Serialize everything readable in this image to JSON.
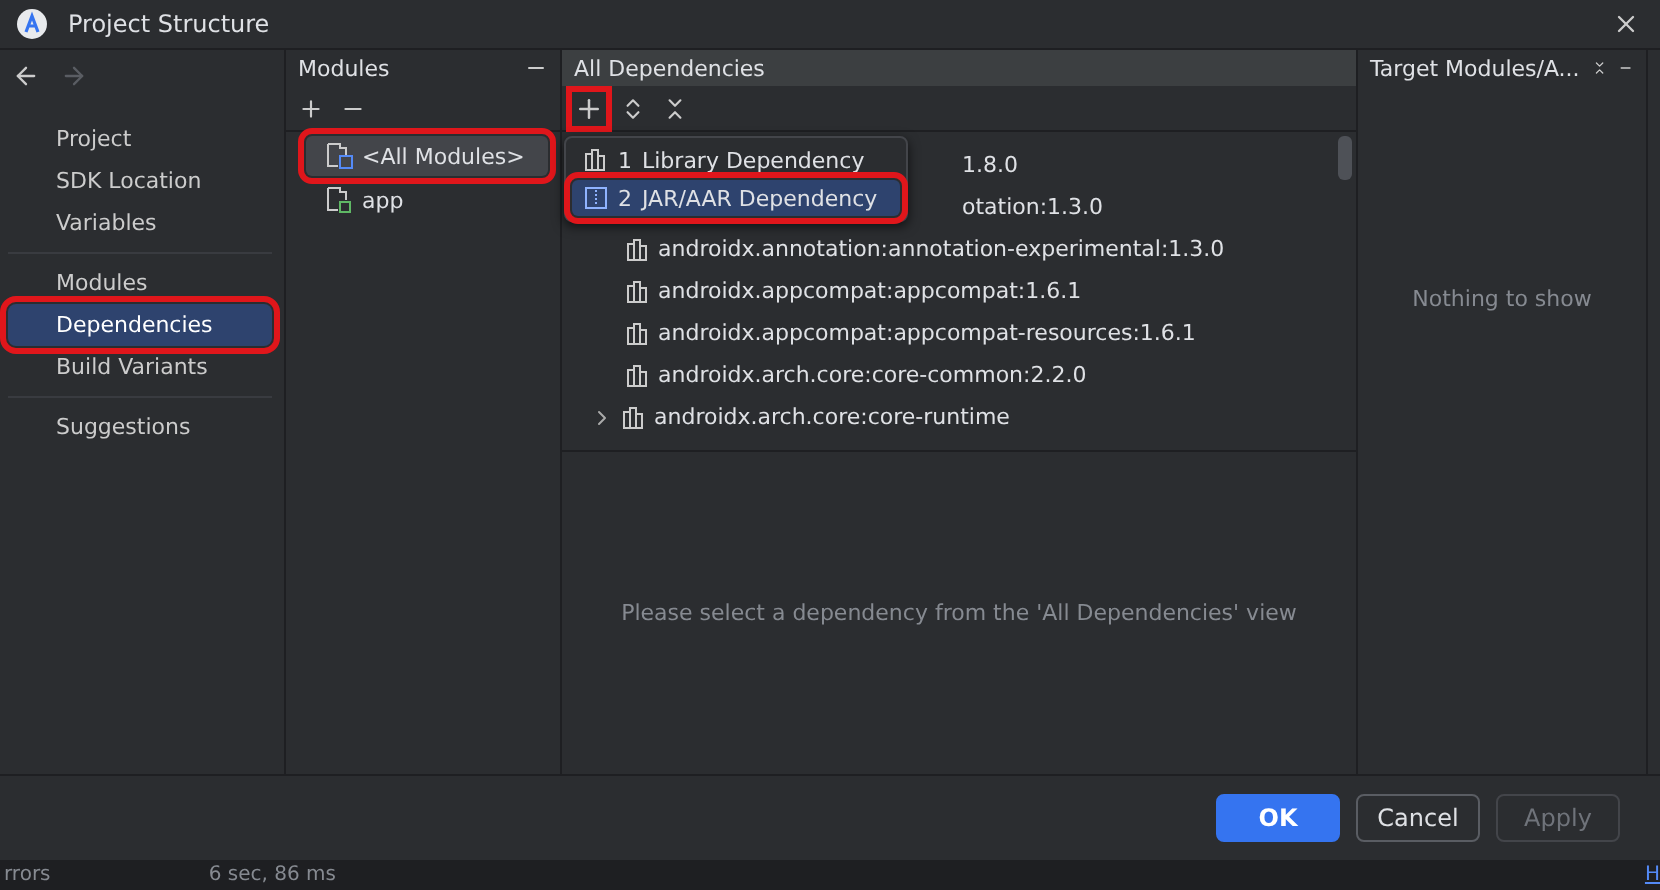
{
  "window": {
    "title": "Project Structure"
  },
  "nav": {
    "sections": [
      {
        "items": [
          {
            "label": "Project",
            "selected": false,
            "highlighted": false
          },
          {
            "label": "SDK Location",
            "selected": false,
            "highlighted": false
          },
          {
            "label": "Variables",
            "selected": false,
            "highlighted": false
          }
        ]
      },
      {
        "items": [
          {
            "label": "Modules",
            "selected": false,
            "highlighted": false
          },
          {
            "label": "Dependencies",
            "selected": true,
            "highlighted": true
          },
          {
            "label": "Build Variants",
            "selected": false,
            "highlighted": false
          }
        ]
      },
      {
        "items": [
          {
            "label": "Suggestions",
            "selected": false,
            "highlighted": false
          }
        ]
      }
    ]
  },
  "modules_panel": {
    "title": "Modules",
    "items": [
      {
        "label": "<All Modules>",
        "kind": "all",
        "selected": true,
        "highlighted": true
      },
      {
        "label": "app",
        "kind": "module",
        "selected": false,
        "highlighted": false
      }
    ]
  },
  "dependencies_panel": {
    "title": "All Dependencies",
    "add_highlighted": true,
    "rows": [
      {
        "label": "1.8.0",
        "expandable": false,
        "covered": true
      },
      {
        "label": "otation:1.3.0",
        "expandable": false,
        "covered": true
      },
      {
        "label": "androidx.annotation:annotation-experimental:1.3.0",
        "expandable": false,
        "covered": false
      },
      {
        "label": "androidx.appcompat:appcompat:1.6.1",
        "expandable": false,
        "covered": false
      },
      {
        "label": "androidx.appcompat:appcompat-resources:1.6.1",
        "expandable": false,
        "covered": false
      },
      {
        "label": "androidx.arch.core:core-common:2.2.0",
        "expandable": false,
        "covered": false
      },
      {
        "label": "androidx.arch.core:core-runtime",
        "expandable": true,
        "covered": false
      }
    ],
    "popup": {
      "items": [
        {
          "number": "1",
          "label": "Library Dependency",
          "kind": "library",
          "selected": false,
          "highlighted": false
        },
        {
          "number": "2",
          "label": "JAR/AAR Dependency",
          "kind": "jar",
          "selected": true,
          "highlighted": true
        }
      ]
    },
    "detail_message": "Please select a dependency from the 'All Dependencies' view"
  },
  "target_panel": {
    "title": "Target Modules/A...",
    "message": "Nothing to show"
  },
  "buttons": [
    {
      "label": "OK",
      "kind": "primary",
      "disabled": false
    },
    {
      "label": "Cancel",
      "kind": "default",
      "disabled": false
    },
    {
      "label": "Apply",
      "kind": "default",
      "disabled": true
    }
  ],
  "background": {
    "status": "rrors",
    "duration": "6 sec, 86 ms",
    "link": "H"
  }
}
